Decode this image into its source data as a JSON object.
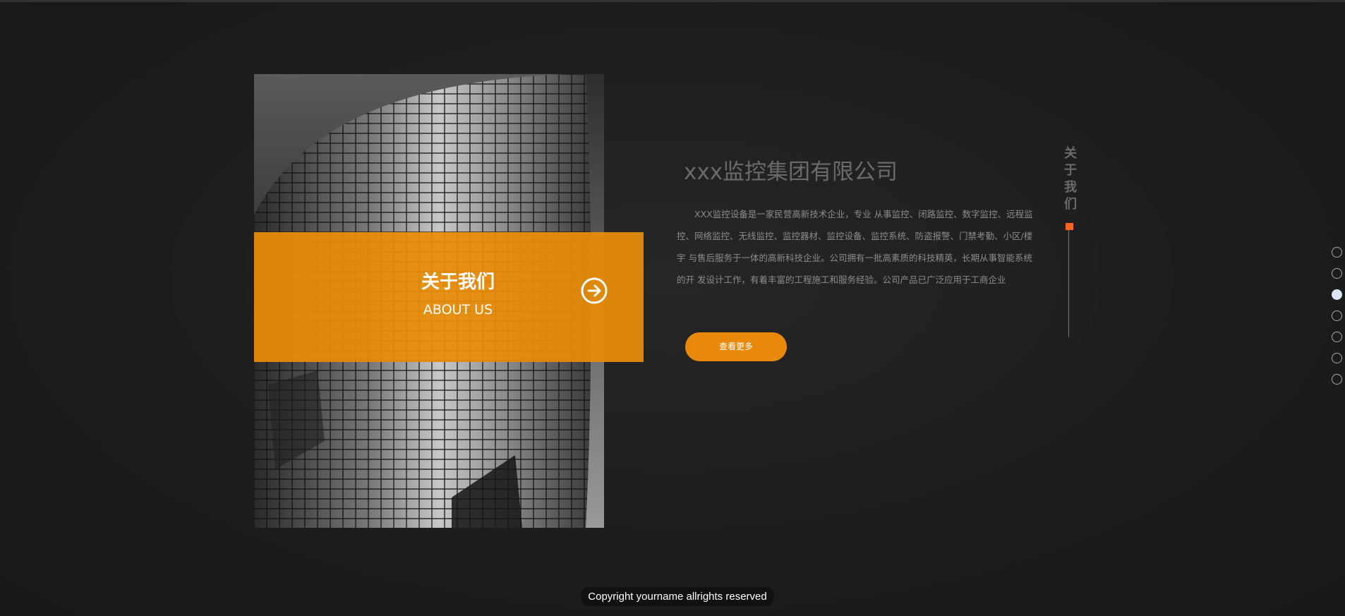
{
  "about": {
    "banner_title": "关于我们",
    "banner_subtitle": "ABOUT US",
    "arrow_icon": "arrow-right-circle-icon",
    "company_name": "xxx监控集团有限公司",
    "description": "XXX监控设备是一家民营高新技术企业，专业 从事监控、闭路监控、数字监控、远程监控、网络监控、无线监控、监控器材、监控设备、监控系统、防盗报警、门禁考勤、小区/楼宇  与售后服务于一体的高新科技企业。公司拥有一批高素质的科技精英，长期从事智能系统的开 发设计工作，有着丰富的工程施工和服务经验。公司产品已广泛应用于工商企业",
    "more_button": "查看更多",
    "vertical_label": [
      "关",
      "于",
      "我",
      "们"
    ]
  },
  "nav_dots": {
    "count": 7,
    "active_index": 2
  },
  "footer": {
    "copyright": "Copyright yourname allrights reserved"
  },
  "colors": {
    "accent_orange": "#e8890b",
    "marker_red": "#f26522",
    "background": "#1d1d1d"
  }
}
